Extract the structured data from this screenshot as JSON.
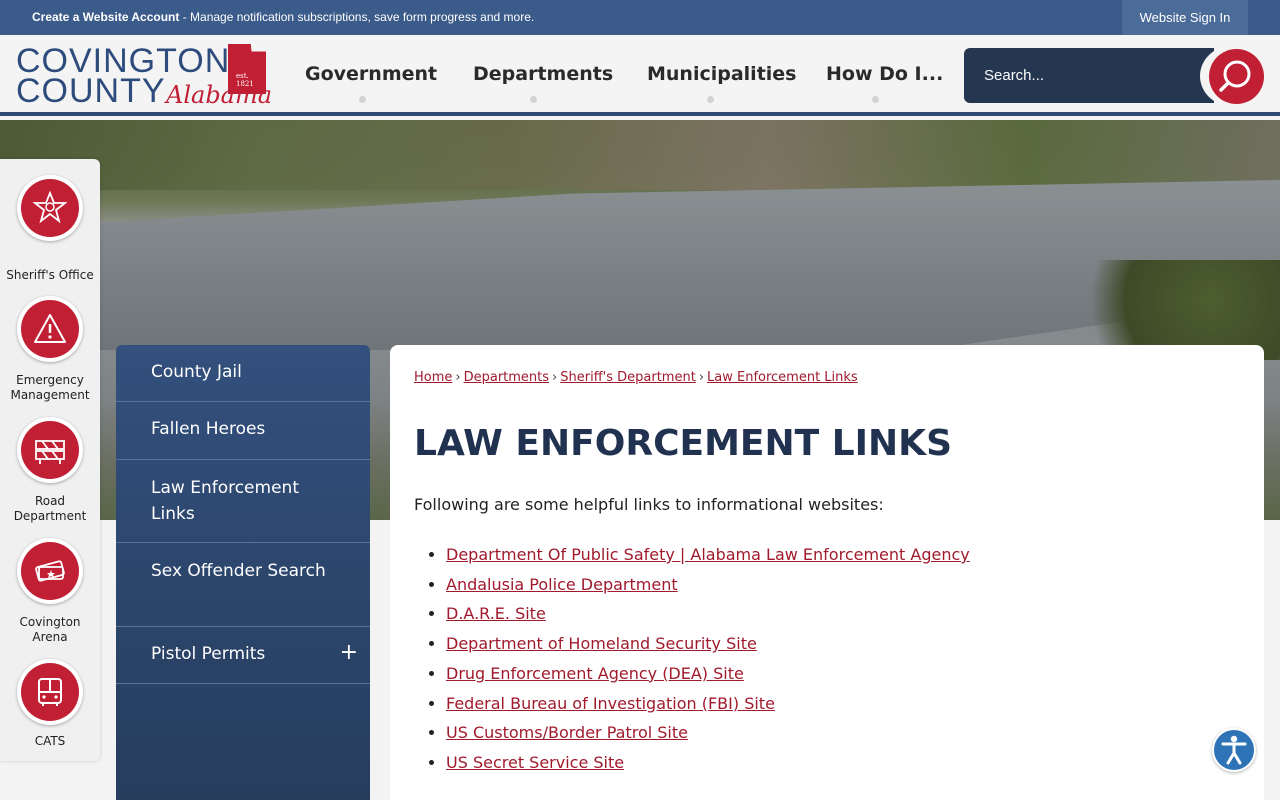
{
  "topbar": {
    "create_account": "Create a Website Account",
    "create_desc": " - Manage notification subscriptions, save form progress and more.",
    "sign_in": "Website Sign In"
  },
  "logo": {
    "line1": "COVINGTON",
    "line2": "COUNTY",
    "script": "Alabama",
    "seal": "est. 1821"
  },
  "nav": [
    "Government",
    "Departments",
    "Municipalities",
    "How Do I..."
  ],
  "search": {
    "placeholder": "Search..."
  },
  "quicklinks": [
    {
      "label": "Sheriff's Office",
      "icon": "sheriff-badge-icon"
    },
    {
      "label": "Emergency Management",
      "icon": "warning-icon"
    },
    {
      "label": "Road Department",
      "icon": "road-barrier-icon"
    },
    {
      "label": "Covington Arena",
      "icon": "tickets-icon"
    },
    {
      "label": "CATS",
      "icon": "bus-icon"
    }
  ],
  "sidemenu": [
    {
      "label": "County Jail",
      "expandable": false
    },
    {
      "label": "Fallen Heroes",
      "expandable": false
    },
    {
      "label": "Law Enforcement Links",
      "expandable": false
    },
    {
      "label": "Sex Offender Search",
      "expandable": false
    },
    {
      "label": "Pistol Permits",
      "expandable": true,
      "toggle": "+"
    }
  ],
  "breadcrumb": [
    "Home",
    "Departments",
    "Sheriff's Department",
    "Law Enforcement Links"
  ],
  "page": {
    "title": "LAW ENFORCEMENT LINKS",
    "intro": "Following are some helpful links to informational websites:",
    "links": [
      "Department Of Public Safety | Alabama Law Enforcement Agency",
      "Andalusia Police Department",
      "D.A.R.E. Site",
      "Department of Homeland Security Site",
      "Drug Enforcement Agency (DEA) Site",
      "Federal Bureau of Investigation (FBI) Site",
      "US Customs/Border Patrol Site",
      "US Secret Service Site"
    ]
  },
  "colors": {
    "brand_blue": "#3b5b8a",
    "brand_red": "#c11f34",
    "link_red": "#a01a2c",
    "dark_navy": "#20324f"
  }
}
